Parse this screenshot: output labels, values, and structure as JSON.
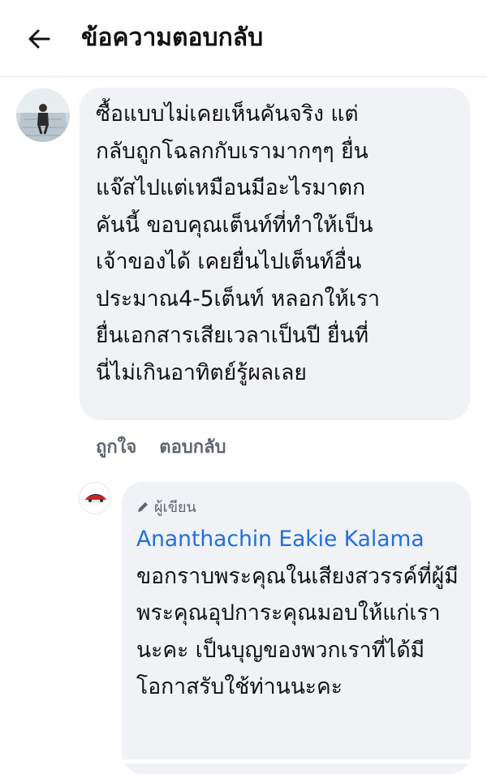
{
  "header": {
    "title": "ข้อความตอบกลับ",
    "back_icon": "arrow-left-icon"
  },
  "comment": {
    "text": "ซื้อแบบไม่เคยเห็นคันจริง แต่\nกลับถูกโฉลกกับเรามากๆๆ ยื่น\nแจ๊สไปแต่เหมือนมีอะไรมาตก\nคันนี้ ขอบคุณเต็นท์ที่ทำให้เป็น\nเจ้าของได้ เคยยื่นไปเต็นท์อื่น\nประมาณ4-5เต็นท์ หลอกให้เรา\nยื่นเอกสารเสียเวลาเป็นปี ยื่นที่\nนี่ไม่เกินอาทิตย์รู้ผลเลย",
    "like_label": "ถูกใจ",
    "reply_label": "ตอบกลับ"
  },
  "reply": {
    "badge_icon": "pencil-icon",
    "badge_label": "ผู้เขียน",
    "author_name": "Ananthachin Eakie Kalama",
    "text": " ขอกราบพระคุณในเสียงสวรรค์ที่ผู้มีพระคุณอุปการะคุณมอบให้แก่เรานะคะ เป็นบุญของพวกเราที่ได้มีโอกาสรับใช้ท่านนะคะ"
  },
  "colors": {
    "bubble": "#f0f2f5",
    "link": "#216fdb",
    "muted": "#606770"
  }
}
